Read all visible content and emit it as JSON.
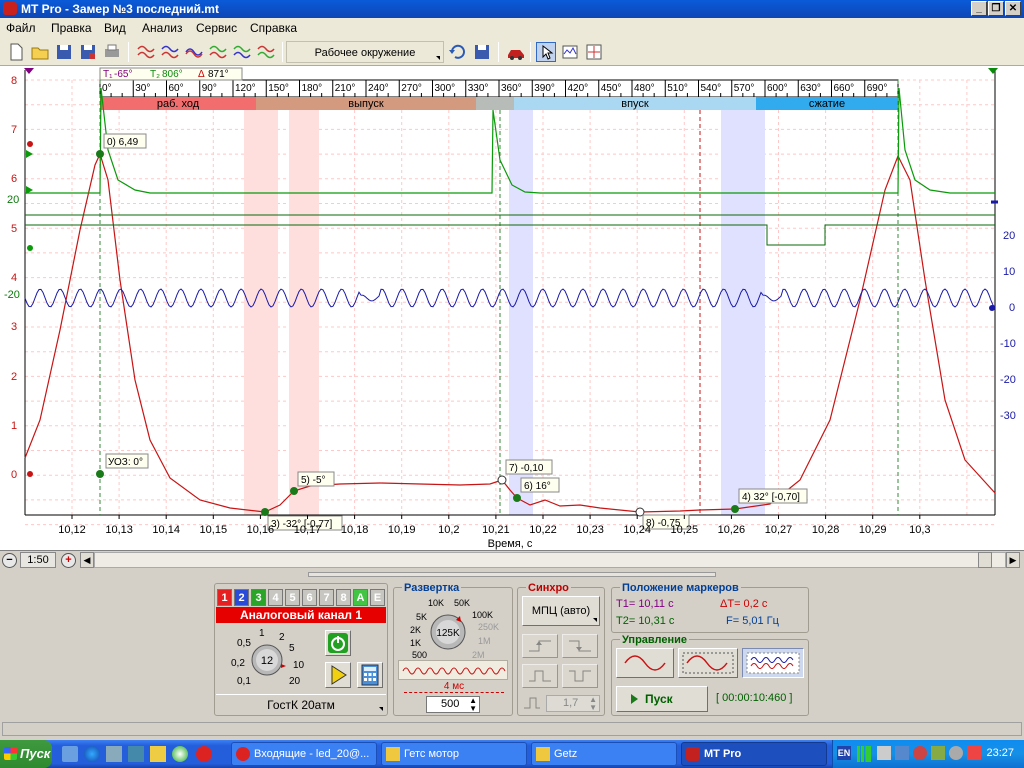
{
  "window": {
    "title": "MT Pro - Замер №3 последний.mt"
  },
  "menu": [
    "Файл",
    "Правка",
    "Вид",
    "Анализ",
    "Сервис",
    "Справка"
  ],
  "toolbar": {
    "workspace_label": "Рабочее окружение"
  },
  "chart": {
    "markers_header": {
      "t1": "-65°",
      "t2": "806°",
      "delta": "871°"
    },
    "angle_ticks": [
      "0°",
      "30°",
      "60°",
      "90°",
      "120°",
      "150°",
      "180°",
      "210°",
      "240°",
      "270°",
      "300°",
      "330°",
      "360°",
      "390°",
      "420°",
      "450°",
      "480°",
      "510°",
      "540°",
      "570°",
      "600°",
      "630°",
      "660°",
      "690°"
    ],
    "phases": [
      {
        "label": "раб. ход",
        "color": "#f26e6e"
      },
      {
        "label": "выпуск",
        "color": "#d49a80"
      },
      {
        "label": "",
        "color": "#b8bcb8"
      },
      {
        "label": "впуск",
        "color": "#aad8f2"
      },
      {
        "label": "сжатие",
        "color": "#32aaee"
      }
    ],
    "left_axis_red": [
      "8",
      "7",
      "6",
      "5",
      "4",
      "3",
      "2",
      "1",
      "0"
    ],
    "left_axis_green": [
      "20",
      "-20"
    ],
    "right_axis_blue": [
      "20",
      "10",
      "0",
      "-10",
      "-20",
      "-30"
    ],
    "x_ticks": [
      "10,12",
      "10,13",
      "10,14",
      "10,15",
      "10,16",
      "10,17",
      "10,18",
      "10,19",
      "10,2",
      "10,21",
      "10,22",
      "10,23",
      "10,24",
      "10,25",
      "10,26",
      "10,27",
      "10,28",
      "10,29",
      "10,3"
    ],
    "x_label": "Время, с",
    "annotations": [
      {
        "id": "0",
        "text": "0) 6,49"
      },
      {
        "id": "uoz",
        "text": "УОЗ: 0°"
      },
      {
        "id": "3",
        "text": "3) -32° [-0,77]"
      },
      {
        "id": "5",
        "text": "5) -5°"
      },
      {
        "id": "7",
        "text": "7) -0,10"
      },
      {
        "id": "6",
        "text": "6) 16°"
      },
      {
        "id": "8",
        "text": "8) -0,75"
      },
      {
        "id": "4",
        "text": "4) 32° [-0,70]"
      }
    ],
    "colors": {
      "red": "#c81414",
      "green": "#0a9a0a",
      "blue": "#1a1aa8"
    }
  },
  "timebar": {
    "scale": "1:50"
  },
  "channels": {
    "tabs": [
      "1",
      "2",
      "3",
      "4",
      "5",
      "6",
      "7",
      "8",
      "A",
      "E"
    ],
    "title": "Аналоговый канал 1",
    "knob_labels": [
      "0,5",
      "1",
      "2",
      "5",
      "0,2",
      "10",
      "0,1",
      "20"
    ],
    "knob_value": "12",
    "sensor": "ГостК 20атм"
  },
  "sweep": {
    "title": "Развертка",
    "knob_labels": [
      "10K",
      "50K",
      "5K",
      "100K",
      "2K",
      "250K",
      "1K",
      "1M",
      "500",
      "2M"
    ],
    "knob_value": "125K",
    "time_label": "4 мс",
    "count_value": "500"
  },
  "sync": {
    "title": "Синхро",
    "mode": "МПЦ (авто)",
    "level_value": "1,7"
  },
  "markers_pos": {
    "title": "Положение маркеров",
    "t1": "T1= 10,11 с",
    "t2": "T2= 10,31 с",
    "dt": "ΔT= 0,2 с",
    "f": "F= 5,01 Гц"
  },
  "control": {
    "title": "Управление",
    "start_label": "Пуск",
    "timer": "[ 00:00:10:460 ]"
  },
  "taskbar": {
    "start_label": "Пуск",
    "tasks": [
      {
        "label": "Входящие - led_20@..."
      },
      {
        "label": "Гетс мотор"
      },
      {
        "label": "Getz"
      },
      {
        "label": "MT Pro"
      }
    ],
    "lang": "EN",
    "clock": "23:27"
  }
}
